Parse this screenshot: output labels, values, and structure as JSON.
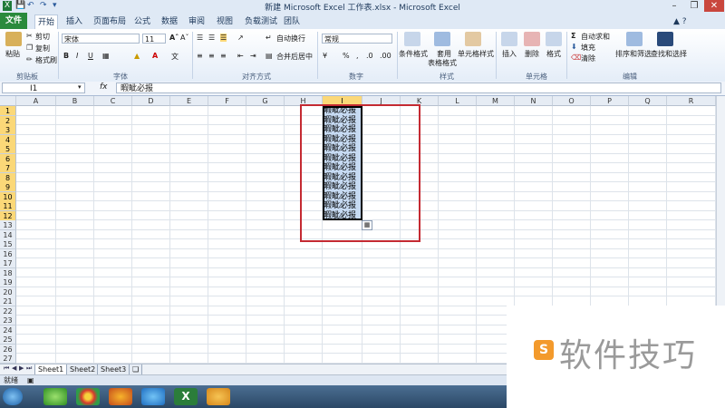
{
  "window": {
    "title": "新建 Microsoft Excel 工作表.xlsx - Microsoft Excel",
    "quick_access": [
      "save-icon",
      "undo-icon",
      "redo-icon",
      "customize-icon"
    ],
    "controls": [
      "minimize-icon",
      "restore-icon",
      "close-icon"
    ]
  },
  "tabs": [
    "文件",
    "开始",
    "插入",
    "页面布局",
    "公式",
    "数据",
    "审阅",
    "视图",
    "负载测试",
    "团队"
  ],
  "active_tab": "开始",
  "ribbon": {
    "clipboard": {
      "paste": "粘贴",
      "cut": "剪切",
      "copy": "复制",
      "format_painter": "格式刷",
      "label": "剪贴板"
    },
    "font": {
      "name": "宋体",
      "size": "11",
      "label": "字体"
    },
    "alignment": {
      "wrap": "自动换行",
      "merge": "合并后居中",
      "label": "对齐方式"
    },
    "number": {
      "format": "常规",
      "label": "数字"
    },
    "styles": {
      "conditional": "条件格式",
      "table_l1": "套用",
      "table_l2": "表格格式",
      "cell_styles": "单元格样式",
      "label": "样式"
    },
    "cells": {
      "insert": "插入",
      "delete": "删除",
      "format": "格式",
      "label": "单元格"
    },
    "editing": {
      "autosum": "自动求和",
      "fill": "填充",
      "clear": "清除",
      "sort": "排序和筛选",
      "find": "查找和选择",
      "label": "编辑"
    }
  },
  "formula_bar": {
    "name_box": "I1",
    "fx": "fx",
    "content": "暇眦必报"
  },
  "columns": [
    "A",
    "B",
    "C",
    "D",
    "E",
    "F",
    "G",
    "H",
    "I",
    "J",
    "K",
    "L",
    "M",
    "N",
    "O",
    "P",
    "Q",
    "R"
  ],
  "selected_column": "I",
  "rows": [
    "1",
    "2",
    "3",
    "4",
    "5",
    "6",
    "7",
    "8",
    "9",
    "10",
    "11",
    "12",
    "13",
    "14",
    "15",
    "16",
    "17",
    "18",
    "19",
    "20",
    "21",
    "22",
    "23",
    "24",
    "25",
    "26",
    "27"
  ],
  "selected_rows": 12,
  "cell_values": [
    "暇眦必报",
    "暇眦必报",
    "暇眦必报",
    "暇眦必报",
    "暇眦必报",
    "暇眦必报",
    "暇眦必报",
    "暇眦必报",
    "暇眦必报",
    "暇眦必报",
    "暇眦必报",
    "暇眦必报"
  ],
  "sheets": [
    "Sheet1",
    "Sheet2",
    "Sheet3"
  ],
  "active_sheet": "Sheet1",
  "status": "就绪",
  "watermark": {
    "logo": "S",
    "text": "软件技巧"
  },
  "colors": {
    "highlight_box": "#c42a32",
    "selection": "#c6daf2",
    "header_selected": "#fbd878",
    "file_tab": "#2a8a3c"
  }
}
